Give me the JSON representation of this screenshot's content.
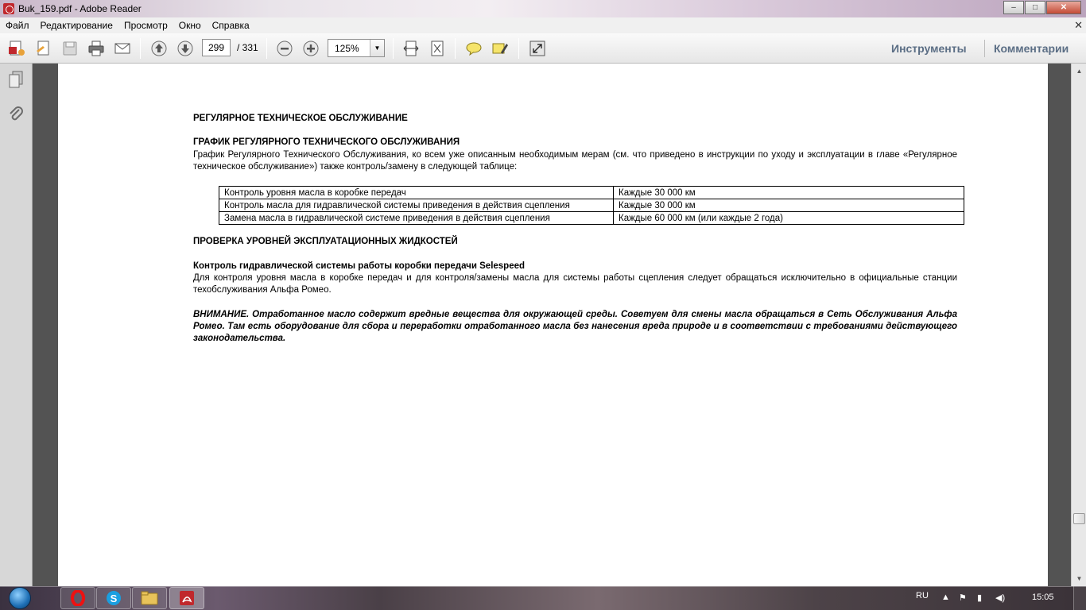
{
  "window": {
    "title": "Buk_159.pdf - Adobe Reader",
    "controls": {
      "minimize": "–",
      "maximize": "□",
      "close": "✕"
    }
  },
  "menu": {
    "items": [
      "Файл",
      "Редактирование",
      "Просмотр",
      "Окно",
      "Справка"
    ],
    "close_glyph": "✕"
  },
  "toolbar": {
    "page_current": "299",
    "page_total": "/ 331",
    "zoom": "125%",
    "tools_label": "Инструменты",
    "comments_label": "Комментарии"
  },
  "document": {
    "heading1": "РЕГУЛЯРНОЕ ТЕХНИЧЕСКОЕ ОБСЛУЖИВАНИЕ",
    "heading2": "ГРАФИК РЕГУЛЯРНОГО ТЕХНИЧЕСКОГО ОБСЛУЖИВАНИЯ",
    "para1": "График Регулярного Технического Обслуживания, ко всем уже описанным необходимым мерам (см.  что приведено в инструкции по уходу и эксплуатации в главе «Регулярное техническое обслуживание»)  также контроль/замену в  следующей таблице:",
    "table": [
      {
        "item": "Контроль уровня масла в коробке передач",
        "interval": "Каждые 30 000 км"
      },
      {
        "item": "Контроль масла для гидравлической системы приведения в действия сцепления",
        "interval": "Каждые 30 000 км"
      },
      {
        "item": "Замена масла в гидравлической системе приведения в действия сцепления",
        "interval": "Каждые 60 000 км (или каждые 2 года)"
      }
    ],
    "heading3": "ПРОВЕРКА УРОВНЕЙ ЭКСПЛУАТАЦИОННЫХ ЖИДКОСТЕЙ",
    "heading4": "Контроль гидравлической системы работы коробки передачи Selespeed",
    "para2": "Для  контроля  уровня  масла  в  коробке  передач  и  для  контроля/замены  масла  для  системы  работы  сцепления   следует  обращаться  исключительно  в официальные станции техобслуживания Альфа Ромео.",
    "warning": "ВНИМАНИЕ. Отработанное масло содержит вредные вещества для окружающей среды. Советуем для смены масла обращаться в Сеть Обслуживания Альфа Ромео. Там есть оборудование для сбора и переработки отработанного масла без нанесения вреда природе и в соответствии с требованиями действующего законодательства."
  },
  "taskbar": {
    "language": "RU",
    "clock": "15:05",
    "apps": [
      "windows-start",
      "opera",
      "skype",
      "file-explorer",
      "adobe-reader"
    ]
  },
  "colors": {
    "tools_link": "#5b6e85",
    "doc_background": "#535353",
    "acrobat_red": "#c0282d"
  }
}
